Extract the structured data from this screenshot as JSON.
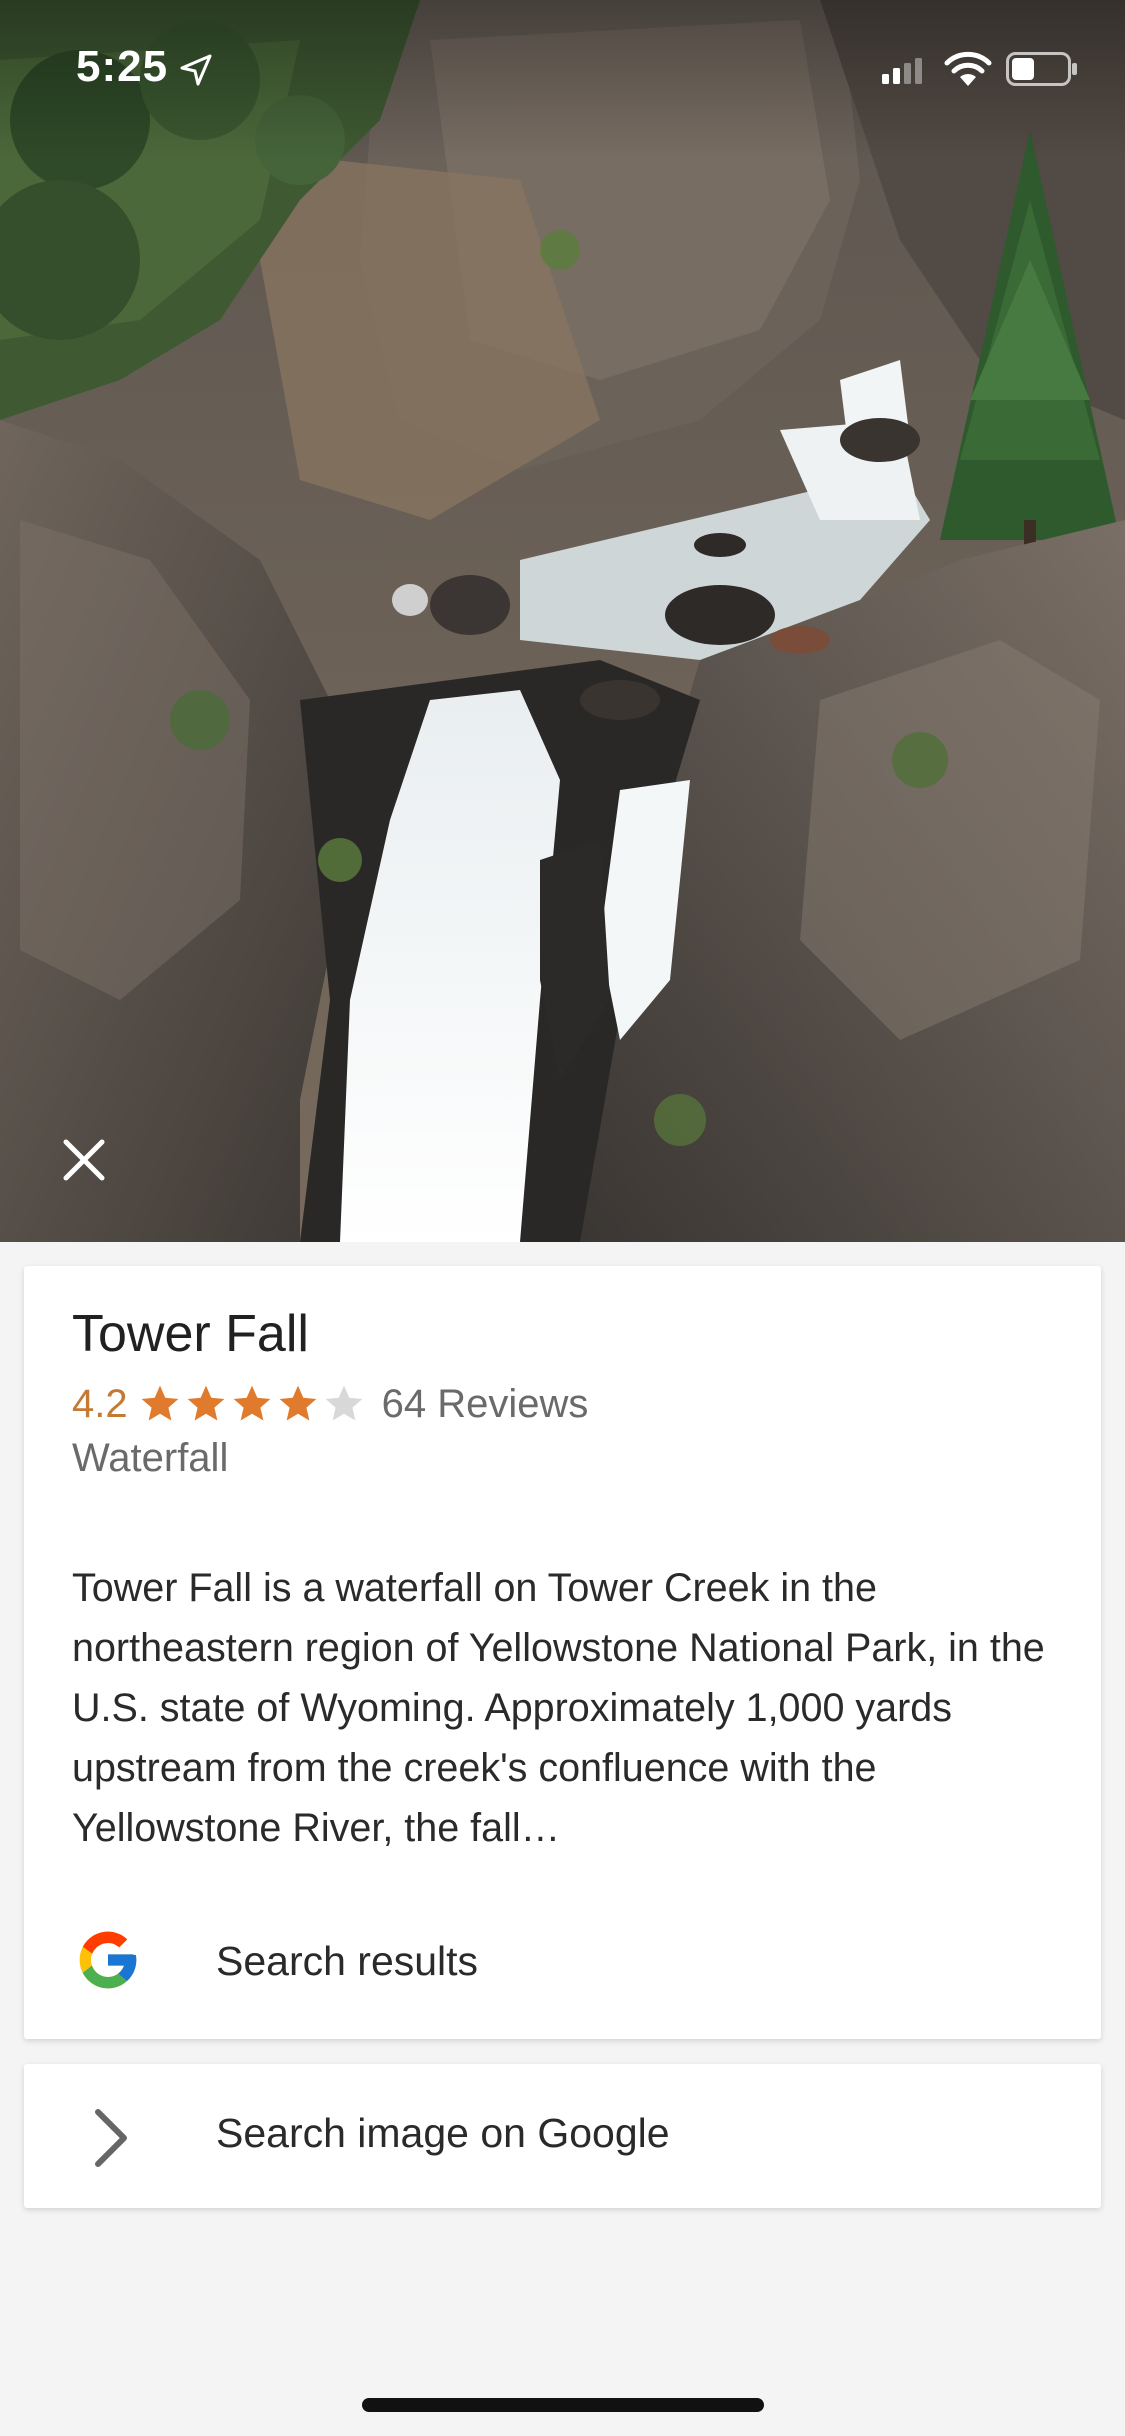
{
  "status_bar": {
    "time": "5:25"
  },
  "photo": {
    "subject": "waterfall-photo"
  },
  "place": {
    "title": "Tower Fall",
    "rating": "4.2",
    "rating_value": 4.2,
    "rating_max": 5,
    "reviews": "64 Reviews",
    "category": "Waterfall",
    "description": "Tower Fall is a waterfall on Tower Creek in the northeastern region of Yellowstone National Park, in the U.S. state of Wyoming. Approximately 1,000 yards upstream from the creek's confluence with the Yellowstone River, the fall…"
  },
  "actions": {
    "search_results_label": "Search results",
    "search_image_label": "Search image on Google"
  },
  "colors": {
    "star_filled": "#e07a2c",
    "star_empty": "#d8d8d8",
    "rating_text": "#c57a34"
  }
}
